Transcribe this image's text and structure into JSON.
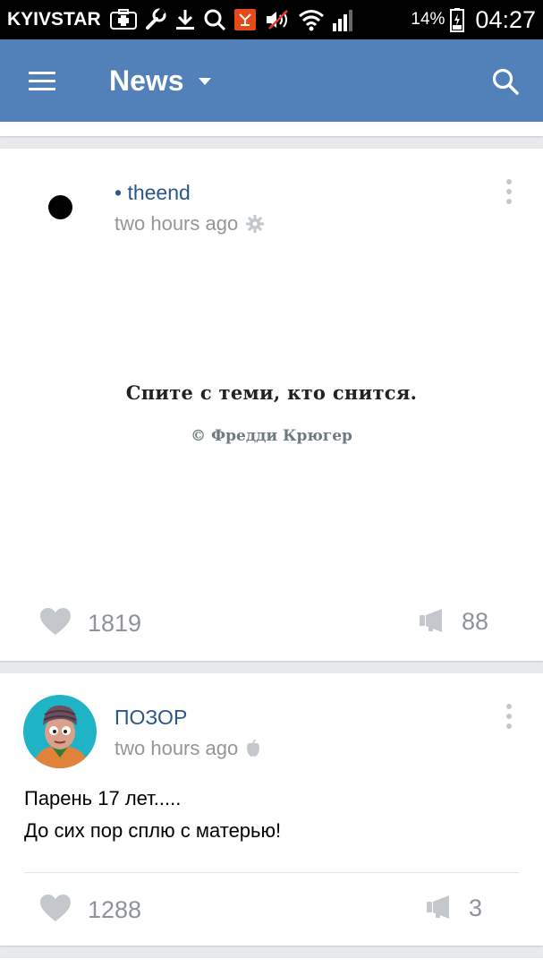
{
  "status_bar": {
    "carrier": "KYIVSTAR",
    "battery_percent": "14%",
    "time": "04:27",
    "icons": [
      "medical-cross-icon",
      "wrench-icon",
      "download-icon",
      "search-icon",
      "app-icon",
      "mute-icon",
      "wifi-icon",
      "signal-icon",
      "battery-charging-icon"
    ]
  },
  "toolbar": {
    "title": "News",
    "color": "#5181b8",
    "menu_icon": "hamburger-menu-icon",
    "search_icon": "search-icon"
  },
  "posts": [
    {
      "author": "• theend",
      "time": "two hours ago",
      "time_icon": "gear-icon",
      "image_text": {
        "quote": "Спите с теми, кто снится.",
        "source": "© Фредди Крюгер"
      },
      "likes": "1819",
      "shares": "88"
    },
    {
      "author": "ПОЗОР",
      "time": "two hours ago",
      "time_icon": "apple-icon",
      "text_lines": [
        "Парень 17 лет.....",
        "До сих пор сплю с матерью!"
      ],
      "likes": "1288",
      "shares": "3"
    }
  ],
  "colors": {
    "link": "#2a5885",
    "muted": "#939699",
    "icon_gray": "#c4c8cc",
    "background": "#e8eaed"
  }
}
